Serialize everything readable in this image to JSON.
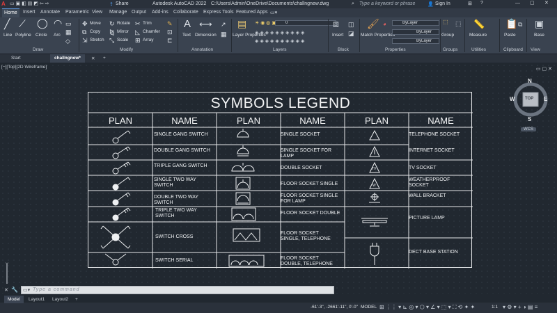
{
  "titlebar": {
    "app_title": "Autodesk AutoCAD 2022",
    "file_path": "C:\\Users\\Admin\\OneDrive\\Documents\\challngnew.dwg",
    "share_label": "Share",
    "search_placeholder": "Type a keyword or phrase",
    "sign_in_label": "Sign In"
  },
  "menu_tabs": [
    "Home",
    "Insert",
    "Annotate",
    "Parametric",
    "View",
    "Manage",
    "Output",
    "Add-ins",
    "Collaborate",
    "Express Tools",
    "Featured Apps"
  ],
  "ribbon": {
    "draw": {
      "line": "Line",
      "polyline": "Polyline",
      "circle": "Circle",
      "arc": "Arc",
      "panel": "Draw"
    },
    "modify": {
      "move": "Move",
      "rotate": "Rotate",
      "trim": "Trim",
      "copy": "Copy",
      "mirror": "Mirror",
      "chamfer": "Chamfer",
      "stretch": "Stretch",
      "scale": "Scale",
      "array": "Array",
      "panel": "Modify"
    },
    "annotation": {
      "text": "Text",
      "dimension": "Dimension",
      "panel": "Annotation"
    },
    "layers": {
      "layer_properties": "Layer Properties",
      "current_layer": "0",
      "panel": "Layers"
    },
    "block": {
      "insert": "Insert",
      "panel": "Block"
    },
    "properties": {
      "match": "Match Properties",
      "color": "ByLayer",
      "linetype": "ByLayer",
      "lineweight": "ByLayer",
      "panel": "Properties"
    },
    "groups": {
      "group": "Group",
      "panel": "Groups"
    },
    "utilities": {
      "measure": "Measure",
      "panel": "Utilities"
    },
    "clipboard": {
      "paste": "Paste",
      "panel": "Clipboard"
    },
    "view": {
      "base": "Base",
      "panel": "View"
    }
  },
  "file_tabs": {
    "start": "Start",
    "active": "challngnew*"
  },
  "viewport_label": "[−][Top][2D Wireframe]",
  "viewcube": {
    "n": "N",
    "s": "S",
    "e": "E",
    "w": "W",
    "face": "TOP",
    "wcs": "WCS"
  },
  "legend": {
    "title": "SYMBOLS LEGEND",
    "headers": [
      "PLAN",
      "NAME",
      "PLAN",
      "NAME",
      "PLAN",
      "NAME"
    ],
    "col1": [
      "SINGLE GANG SWITCH",
      "DOUBLE GANG SWITCH",
      "TRIPLE GANG SWITCH",
      "SINGLE TWO WAY SWITCH",
      "DOUBLE TWO WAY SWITCH",
      "TRIPLE TWO WAY SWITCH",
      "SWITCH CROSS",
      "SWITCH SERIAL"
    ],
    "col2": [
      "SINGLE SOCKET",
      "SINGLE SOCKET FOR LAMP",
      "DOUBLE SOCKET",
      "FLOOR SOCKET SINGLE",
      "FLOOR SOCKET SINGLE FOR LAMP",
      "FLOOR SOCKET DOUBLE",
      "FLOOR SOCKET SINGLE, TELEPHONE",
      "FLOOR SOCKET DOUBLE, TELEPHONE"
    ],
    "col3": [
      "TELEPHONE SOCKET",
      "INTERNET SOCKET",
      "TV SOCKET",
      "WEATHERPROOF SOCKET",
      "WALL BRACKET",
      "PICTURE LAMP",
      "DECT BASE STATION"
    ],
    "symbol_text": {
      "tv": "TV",
      "wp": "W"
    }
  },
  "command_line": {
    "placeholder": "Type a command"
  },
  "layout_tabs": [
    "Model",
    "Layout1",
    "Layout2"
  ],
  "status": {
    "coords": "-61'-3\", -2661'-11\", 0'-0\"",
    "model": "MODEL",
    "scale": "1:1"
  }
}
